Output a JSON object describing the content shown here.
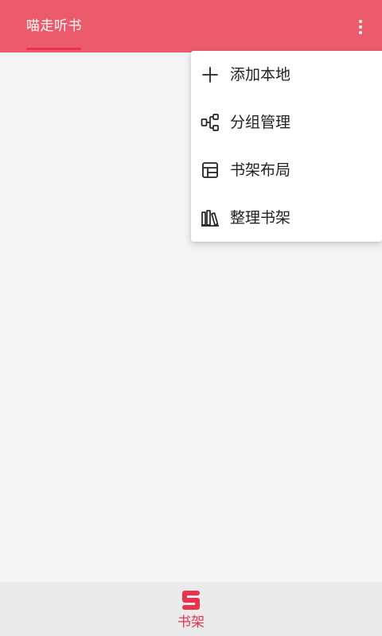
{
  "app": {
    "tab_title": "喵走听书",
    "accent_color": "#ec5b6c",
    "more_icon": "more-vertical-icon"
  },
  "menu": {
    "items": [
      {
        "label": "添加本地",
        "icon": "plus-icon"
      },
      {
        "label": "分组管理",
        "icon": "group-tree-icon"
      },
      {
        "label": "书架布局",
        "icon": "layout-icon"
      },
      {
        "label": "整理书架",
        "icon": "books-icon"
      }
    ]
  },
  "bottom_nav": {
    "items": [
      {
        "label": "书架",
        "icon": "bookshelf-icon",
        "active": true,
        "color": "#e8334a"
      }
    ]
  }
}
